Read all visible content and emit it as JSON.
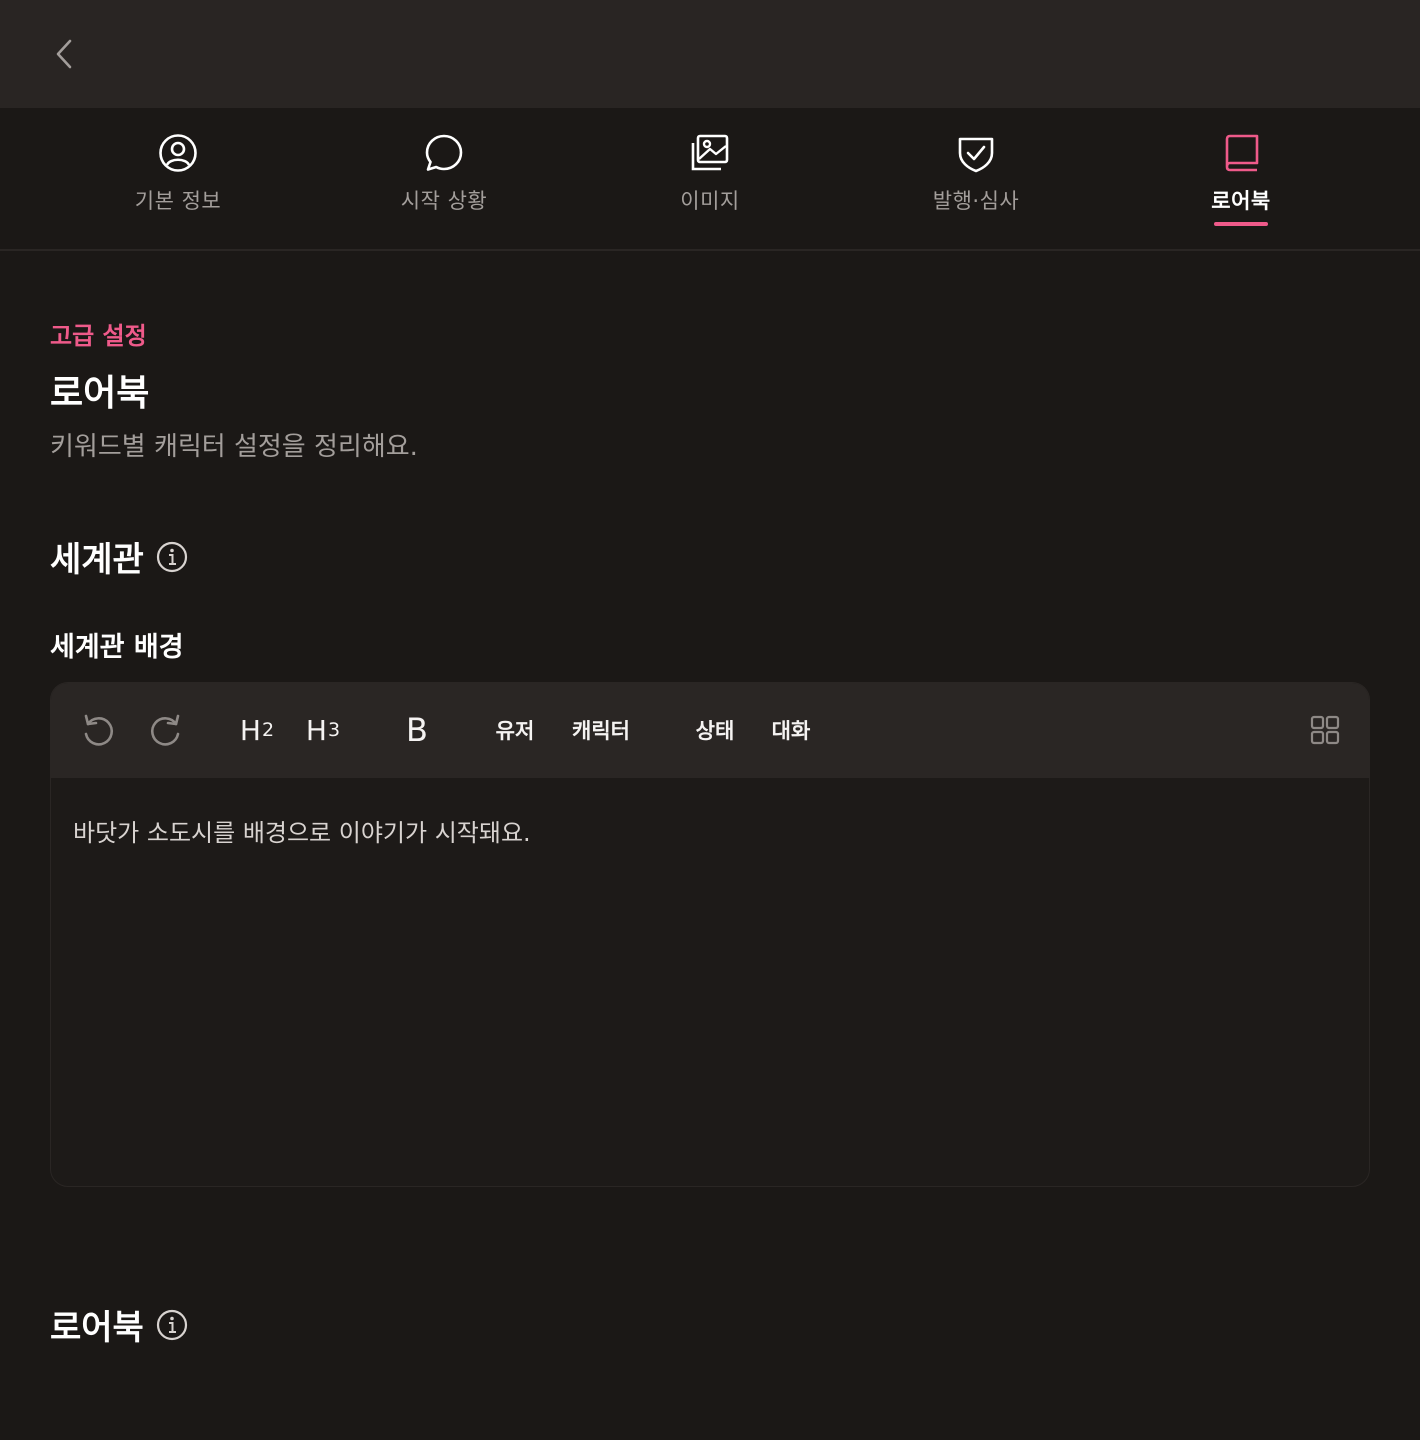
{
  "tabs": [
    {
      "label": "기본 정보",
      "icon": "user-circle-icon"
    },
    {
      "label": "시작 상황",
      "icon": "chat-bubble-icon"
    },
    {
      "label": "이미지",
      "icon": "image-icon"
    },
    {
      "label": "발행·심사",
      "icon": "shield-check-icon"
    },
    {
      "label": "로어북",
      "icon": "book-icon",
      "active": true
    }
  ],
  "header": {
    "eyebrow": "고급 설정",
    "title": "로어북",
    "description": "키워드별 캐릭터 설정을 정리해요."
  },
  "worldview": {
    "section_title": "세계관",
    "field_label": "세계관 배경",
    "toolbar": {
      "h2_base": "H",
      "h2_sub": "2",
      "h3_base": "H",
      "h3_sub": "3",
      "bold": "B",
      "user": "유저",
      "character": "캐릭터",
      "status": "상태",
      "dialogue": "대화"
    },
    "content": "바닷가 소도시를 배경으로 이야기가 시작돼요."
  },
  "lorebook": {
    "section_title": "로어북"
  },
  "colors": {
    "accent": "#ef5a8a",
    "background": "#1b1816",
    "topbar": "#292523",
    "toolbar": "#2a2624",
    "muted_text": "#a39e9b"
  }
}
